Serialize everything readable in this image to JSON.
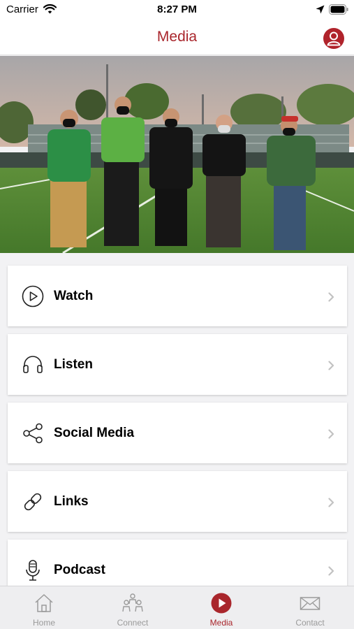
{
  "status_bar": {
    "carrier": "Carrier",
    "time": "8:27 PM"
  },
  "nav": {
    "title": "Media",
    "profile_icon": "person-icon"
  },
  "colors": {
    "accent": "#a9262c",
    "tab_inactive": "#9a9a9a",
    "turf": "#4f8a2c"
  },
  "menu": {
    "items": [
      {
        "label": "Watch",
        "icon": "play-icon"
      },
      {
        "label": "Listen",
        "icon": "headphones-icon"
      },
      {
        "label": "Social Media",
        "icon": "share-icon"
      },
      {
        "label": "Links",
        "icon": "link-icon"
      },
      {
        "label": "Podcast",
        "icon": "microphone-icon"
      }
    ]
  },
  "tabs": [
    {
      "label": "Home",
      "icon": "home-icon"
    },
    {
      "label": "Connect",
      "icon": "people-icon"
    },
    {
      "label": "Media",
      "icon": "play-circle-icon",
      "active": true
    },
    {
      "label": "Contact",
      "icon": "envelope-icon"
    }
  ]
}
